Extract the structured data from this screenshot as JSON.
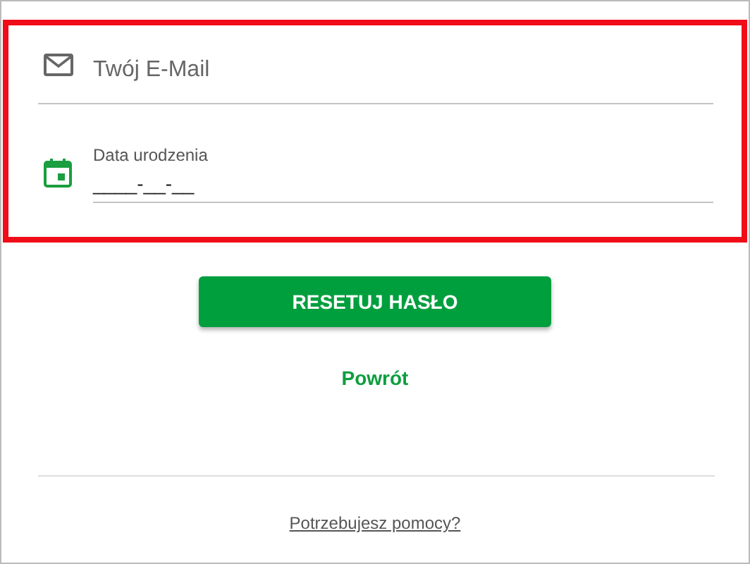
{
  "email_field": {
    "placeholder": "Twój E-Mail"
  },
  "birth_date_field": {
    "label": "Data urodzenia",
    "value": "____-__-__"
  },
  "reset_button": {
    "label": "RESETUJ HASŁO"
  },
  "back_link": {
    "label": "Powrót"
  },
  "help_link": {
    "label": "Potrzebujesz pomocy?"
  }
}
